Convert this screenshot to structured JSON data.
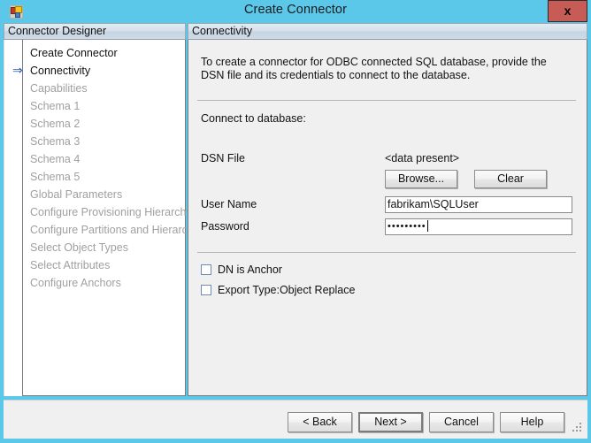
{
  "window": {
    "title": "Create Connector",
    "app_icon": "connector-designer-icon",
    "close_label": "x"
  },
  "left_panel": {
    "header": "Connector Designer",
    "active_index": 1,
    "items": [
      {
        "label": "Create Connector",
        "enabled": true,
        "arrow": false
      },
      {
        "label": "Connectivity",
        "enabled": true,
        "arrow": true
      },
      {
        "label": "Capabilities",
        "enabled": false,
        "arrow": false
      },
      {
        "label": "Schema 1",
        "enabled": false,
        "arrow": false
      },
      {
        "label": "Schema 2",
        "enabled": false,
        "arrow": false
      },
      {
        "label": "Schema 3",
        "enabled": false,
        "arrow": false
      },
      {
        "label": "Schema 4",
        "enabled": false,
        "arrow": false
      },
      {
        "label": "Schema 5",
        "enabled": false,
        "arrow": false
      },
      {
        "label": "Global Parameters",
        "enabled": false,
        "arrow": false
      },
      {
        "label": "Configure Provisioning Hierarchy",
        "enabled": false,
        "arrow": false
      },
      {
        "label": "Configure Partitions and Hierarchies",
        "enabled": false,
        "arrow": false
      },
      {
        "label": "Select Object Types",
        "enabled": false,
        "arrow": false
      },
      {
        "label": "Select Attributes",
        "enabled": false,
        "arrow": false
      },
      {
        "label": "Configure Anchors",
        "enabled": false,
        "arrow": false
      }
    ],
    "arrow_glyph": "⇒"
  },
  "right_panel": {
    "header": "Connectivity",
    "intro": "To create a connector for ODBC connected SQL database, provide the DSN file and its credentials to connect to the database.",
    "section_label": "Connect to database:",
    "dsn": {
      "label": "DSN File",
      "value": "<data present>",
      "browse_label": "Browse...",
      "clear_label": "Clear"
    },
    "username": {
      "label": "User Name",
      "value": "fabrikam\\SQLUser",
      "placeholder": ""
    },
    "password": {
      "label": "Password",
      "masked_value": "•••••••••",
      "placeholder": ""
    },
    "checkboxes": [
      {
        "label": "DN is Anchor",
        "checked": false
      },
      {
        "label": "Export Type:Object Replace",
        "checked": false
      }
    ]
  },
  "footer": {
    "back_label": "< Back",
    "next_label": "Next  >",
    "cancel_label": "Cancel",
    "help_label": "Help",
    "focused_button": "Next  >"
  },
  "colors": {
    "title_bar": "#5bc8ea",
    "close_button": "#c75b55",
    "panel_background": "#f0f0f0",
    "field_background": "#ffffff",
    "arrow_accent": "#2255bb",
    "disabled_text": "#a0a0a0"
  }
}
